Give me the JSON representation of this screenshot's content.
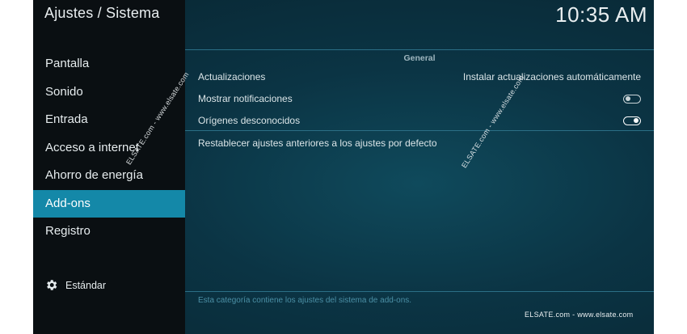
{
  "header": {
    "title": "Ajustes / Sistema",
    "clock": "10:35 AM"
  },
  "sidebar": {
    "items": [
      {
        "label": "Pantalla"
      },
      {
        "label": "Sonido"
      },
      {
        "label": "Entrada"
      },
      {
        "label": "Acceso a internet"
      },
      {
        "label": "Ahorro de energía"
      },
      {
        "label": "Add-ons",
        "active": true
      },
      {
        "label": "Registro"
      }
    ],
    "level": {
      "icon": "gear-icon",
      "label": "Estándar"
    }
  },
  "content": {
    "group_title": "General",
    "settings": [
      {
        "label": "Actualizaciones",
        "value": "Instalar actualizaciones automáticamente"
      },
      {
        "label": "Mostrar notificaciones",
        "toggle": "off"
      },
      {
        "label": "Orígenes desconocidos",
        "toggle": "on"
      },
      {
        "label": "Restablecer ajustes anteriores a los ajustes por defecto"
      }
    ],
    "description": "Esta categoría contiene los ajustes del sistema de add-ons."
  },
  "watermarks": {
    "diagonal": "ELSATE.com - www.elsate.com",
    "bottom": "ELSATE.com - www.elsate.com"
  },
  "colors": {
    "accent": "#1488a8",
    "sidebar_bg": "#0a0f12",
    "content_bg": "#0b3444"
  }
}
